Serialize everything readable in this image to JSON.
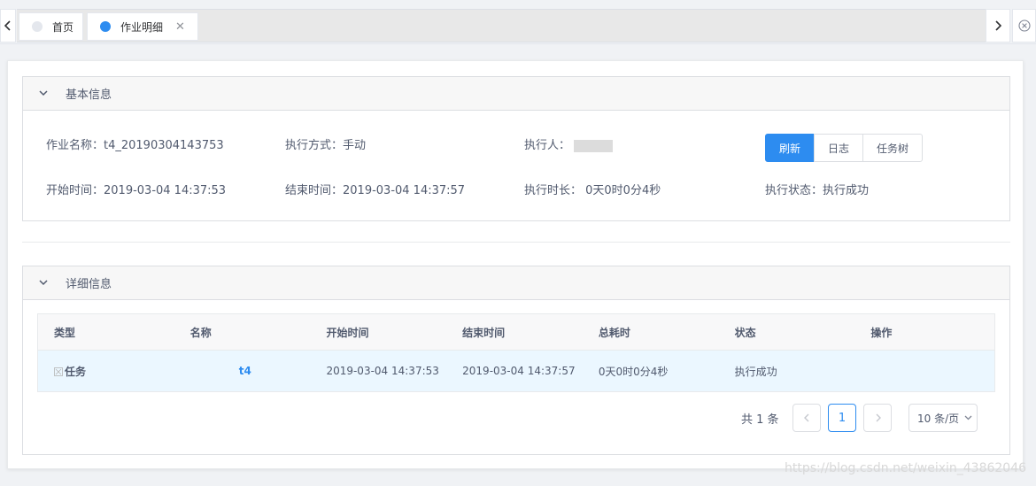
{
  "tabs": [
    {
      "label": "首页",
      "active": false
    },
    {
      "label": "作业明细",
      "active": true
    }
  ],
  "basic_panel": {
    "title": "基本信息",
    "job_name": "作业名称：t4_20190304143753",
    "exec_mode": "执行方式：手动",
    "executor_label": "执行人：",
    "start_time": "开始时间：2019-03-04 14:37:53",
    "end_time": "结束时间：2019-03-04 14:37:57",
    "duration": "执行时长：  0天0时0分4秒",
    "status": "执行状态：执行成功",
    "buttons": {
      "refresh": "刷新",
      "log": "日志",
      "task_tree": "任务树"
    }
  },
  "detail_panel": {
    "title": "详细信息",
    "columns": [
      "类型",
      "名称",
      "开始时间",
      "结束时间",
      "总耗时",
      "状态",
      "操作"
    ],
    "rows": [
      {
        "type": "任务",
        "name": "t4",
        "start": "2019-03-04 14:37:53",
        "end": "2019-03-04 14:37:57",
        "elapsed": "0天0时0分4秒",
        "status": "执行成功",
        "action": ""
      }
    ]
  },
  "pagination": {
    "total": "共 1 条",
    "current_page": "1",
    "page_size": "10 条/页"
  },
  "watermark": "https://blog.csdn.net/weixin_43862046",
  "colors": {
    "primary": "#2d8cf0",
    "row_highlight": "#ebf7ff"
  }
}
